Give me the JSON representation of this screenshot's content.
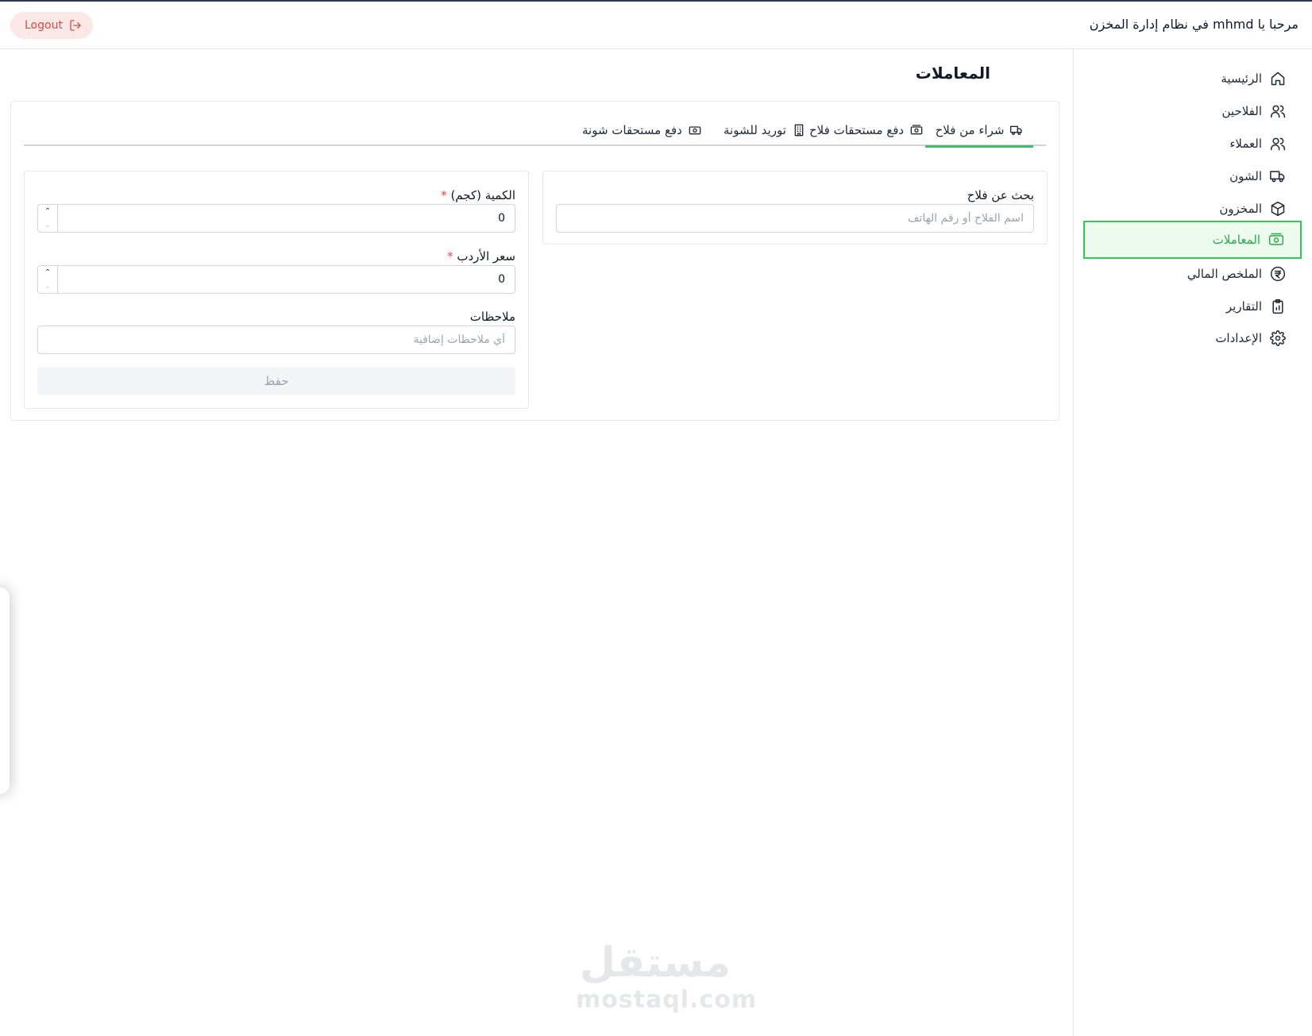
{
  "header": {
    "welcome_text": "مرحبا يا mhmd في نظام إدارة المخزن",
    "logout_label": "Logout"
  },
  "sidebar": {
    "items": [
      {
        "label": "الرئيسية",
        "icon": "home-icon"
      },
      {
        "label": "الفلاحين",
        "icon": "users-icon"
      },
      {
        "label": "العملاء",
        "icon": "users-icon"
      },
      {
        "label": "الشون",
        "icon": "truck-icon"
      },
      {
        "label": "المخزون",
        "icon": "box-icon"
      },
      {
        "label": "المعاملات",
        "icon": "cash-icon",
        "active": true
      },
      {
        "label": "الملخص المالي",
        "icon": "currency-icon"
      },
      {
        "label": "التقارير",
        "icon": "clipboard-icon"
      },
      {
        "label": "الإعدادات",
        "icon": "gear-icon"
      }
    ],
    "accent_color": "#34c759"
  },
  "main": {
    "title": "المعاملات",
    "tabs": [
      {
        "label": "شراء من فلاح",
        "icon": "truck-icon",
        "active": true
      },
      {
        "label": "دفع مستحقات فلاح",
        "icon": "cash-icon"
      },
      {
        "label": "توريد للشونة",
        "icon": "building-icon"
      },
      {
        "label": "دفع مستحقات شونة",
        "icon": "cash-icon"
      }
    ],
    "search": {
      "label": "بحث عن فلاح",
      "placeholder": "اسم الفلاح أو رقم الهاتف"
    },
    "form": {
      "quantity_label": "الكمية (كجم)",
      "quantity_value": "0",
      "price_label": "سعر الأردب",
      "price_value": "0",
      "required_mark": "*",
      "notes_label": "ملاحظات",
      "notes_placeholder": "أي ملاحظات إضافية",
      "save_label": "حفظ"
    }
  },
  "watermark": {
    "arabic": "مستقل",
    "latin": "mostaql.com"
  }
}
